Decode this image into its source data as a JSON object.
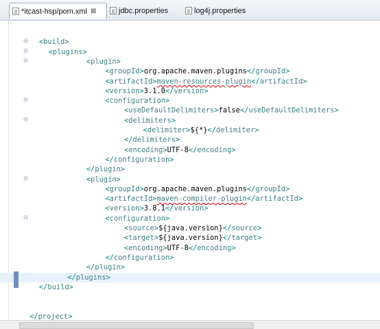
{
  "tabs": [
    {
      "label": "*itcast-hsp/pom.xml",
      "active": true,
      "close": "⊠"
    },
    {
      "label": "jdbc.properties",
      "active": false
    },
    {
      "label": "log4j.properties",
      "active": false
    }
  ],
  "lines": [
    {
      "indent": 0,
      "fold": false,
      "parts": []
    },
    {
      "indent": 2,
      "fold": true,
      "parts": [
        {
          "t": "<"
        },
        {
          "n": "build"
        },
        {
          "t": ">"
        }
      ]
    },
    {
      "indent": 4,
      "fold": true,
      "parts": [
        {
          "t": "<"
        },
        {
          "n": "plugins"
        },
        {
          "t": ">"
        }
      ]
    },
    {
      "indent": 12,
      "fold": true,
      "parts": [
        {
          "t": "<"
        },
        {
          "n": "plugin"
        },
        {
          "t": ">"
        }
      ]
    },
    {
      "indent": 16,
      "fold": false,
      "parts": [
        {
          "t": "<"
        },
        {
          "n": "groupId"
        },
        {
          "t": ">"
        },
        {
          "x": "org.apache.maven.plugins"
        },
        {
          "t": "</"
        },
        {
          "n": "groupId"
        },
        {
          "t": ">"
        }
      ]
    },
    {
      "indent": 16,
      "fold": false,
      "parts": [
        {
          "t": "<"
        },
        {
          "n": "artifactId"
        },
        {
          "t": ">"
        },
        {
          "e": "maven-resources-plugin"
        },
        {
          "t": "</"
        },
        {
          "n": "artifactId"
        },
        {
          "t": ">"
        }
      ]
    },
    {
      "indent": 16,
      "fold": false,
      "parts": [
        {
          "t": "<"
        },
        {
          "n": "version"
        },
        {
          "t": ">"
        },
        {
          "x": "3.1.0"
        },
        {
          "t": "</"
        },
        {
          "n": "version"
        },
        {
          "t": ">"
        }
      ]
    },
    {
      "indent": 16,
      "fold": true,
      "parts": [
        {
          "t": "<"
        },
        {
          "n": "configuration"
        },
        {
          "t": ">"
        }
      ]
    },
    {
      "indent": 20,
      "fold": false,
      "parts": [
        {
          "t": "<"
        },
        {
          "n": "useDefaultDelimiters"
        },
        {
          "t": ">"
        },
        {
          "x": "false"
        },
        {
          "t": "</"
        },
        {
          "n": "useDefaultDelimiters"
        },
        {
          "t": ">"
        }
      ]
    },
    {
      "indent": 20,
      "fold": true,
      "parts": [
        {
          "t": "<"
        },
        {
          "n": "delimiters"
        },
        {
          "t": ">"
        }
      ]
    },
    {
      "indent": 24,
      "fold": false,
      "parts": [
        {
          "t": "<"
        },
        {
          "n": "delimiter"
        },
        {
          "t": ">"
        },
        {
          "x": "${*}"
        },
        {
          "t": "</"
        },
        {
          "n": "delimiter"
        },
        {
          "t": ">"
        }
      ]
    },
    {
      "indent": 20,
      "fold": false,
      "parts": [
        {
          "t": "</"
        },
        {
          "n": "delimiters"
        },
        {
          "t": ">"
        }
      ]
    },
    {
      "indent": 20,
      "fold": false,
      "parts": [
        {
          "t": "<"
        },
        {
          "n": "encoding"
        },
        {
          "t": ">"
        },
        {
          "x": "UTF-8"
        },
        {
          "t": "</"
        },
        {
          "n": "encoding"
        },
        {
          "t": ">"
        }
      ]
    },
    {
      "indent": 16,
      "fold": false,
      "parts": [
        {
          "t": "</"
        },
        {
          "n": "configuration"
        },
        {
          "t": ">"
        }
      ]
    },
    {
      "indent": 12,
      "fold": false,
      "parts": [
        {
          "t": "</"
        },
        {
          "n": "plugin"
        },
        {
          "t": ">"
        }
      ]
    },
    {
      "indent": 12,
      "fold": true,
      "parts": [
        {
          "t": "<"
        },
        {
          "n": "plugin"
        },
        {
          "t": ">"
        }
      ]
    },
    {
      "indent": 16,
      "fold": false,
      "parts": [
        {
          "t": "<"
        },
        {
          "n": "groupId"
        },
        {
          "t": ">"
        },
        {
          "x": "org.apache.maven.plugins"
        },
        {
          "t": "</"
        },
        {
          "n": "groupId"
        },
        {
          "t": ">"
        }
      ]
    },
    {
      "indent": 16,
      "fold": false,
      "parts": [
        {
          "t": "<"
        },
        {
          "n": "artifactId"
        },
        {
          "t": ">"
        },
        {
          "e": "maven-compiler-plugin"
        },
        {
          "t": "</"
        },
        {
          "n": "artifactId"
        },
        {
          "t": ">"
        }
      ]
    },
    {
      "indent": 16,
      "fold": false,
      "parts": [
        {
          "t": "<"
        },
        {
          "n": "version"
        },
        {
          "t": ">"
        },
        {
          "x": "3.8.1"
        },
        {
          "t": "</"
        },
        {
          "n": "version"
        },
        {
          "t": ">"
        }
      ]
    },
    {
      "indent": 16,
      "fold": true,
      "parts": [
        {
          "t": "<"
        },
        {
          "n": "configuration"
        },
        {
          "t": ">"
        }
      ]
    },
    {
      "indent": 20,
      "fold": false,
      "parts": [
        {
          "t": "<"
        },
        {
          "n": "source"
        },
        {
          "t": ">"
        },
        {
          "x": "${java.version}"
        },
        {
          "t": "</"
        },
        {
          "n": "source"
        },
        {
          "t": ">"
        }
      ]
    },
    {
      "indent": 20,
      "fold": false,
      "parts": [
        {
          "t": "<"
        },
        {
          "n": "target"
        },
        {
          "t": ">"
        },
        {
          "x": "${java.version}"
        },
        {
          "t": "</"
        },
        {
          "n": "target"
        },
        {
          "t": ">"
        }
      ]
    },
    {
      "indent": 20,
      "fold": false,
      "parts": [
        {
          "t": "<"
        },
        {
          "n": "encoding"
        },
        {
          "t": ">"
        },
        {
          "x": "UTF-8"
        },
        {
          "t": "</"
        },
        {
          "n": "encoding"
        },
        {
          "t": ">"
        }
      ]
    },
    {
      "indent": 16,
      "fold": false,
      "parts": [
        {
          "t": "</"
        },
        {
          "n": "configuration"
        },
        {
          "t": ">"
        }
      ]
    },
    {
      "indent": 12,
      "fold": false,
      "parts": [
        {
          "t": "</"
        },
        {
          "n": "plugin"
        },
        {
          "t": ">"
        }
      ]
    },
    {
      "indent": 8,
      "fold": false,
      "current": true,
      "parts": [
        {
          "t": "</"
        },
        {
          "n": "plugins"
        },
        {
          "t": ">"
        }
      ]
    },
    {
      "indent": 2,
      "fold": false,
      "parts": [
        {
          "t": "</"
        },
        {
          "n": "build"
        },
        {
          "t": ">"
        }
      ]
    },
    {
      "indent": 0,
      "fold": false,
      "parts": []
    },
    {
      "indent": 0,
      "fold": false,
      "parts": []
    },
    {
      "indent": 0,
      "fold": false,
      "parts": [
        {
          "t": "</"
        },
        {
          "n": "project"
        },
        {
          "t": ">"
        }
      ]
    }
  ],
  "colors": {
    "bracket": "#008080",
    "tag": "#3f7f7f",
    "text": "#000000",
    "current_line": "#e8f2fe",
    "error_underline": "#d60000"
  }
}
